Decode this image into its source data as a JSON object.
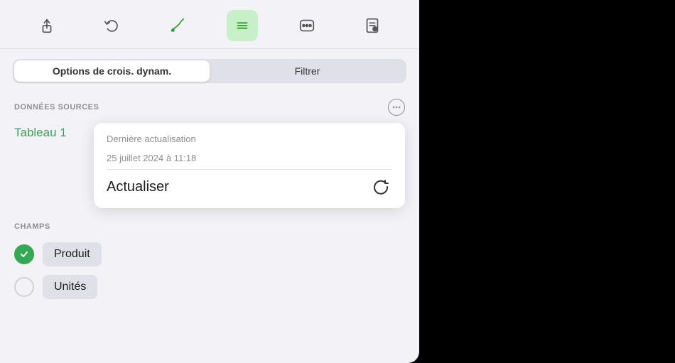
{
  "toolbar": {
    "buttons": [
      {
        "id": "share",
        "icon": "share",
        "active": false,
        "label": "Partager"
      },
      {
        "id": "undo",
        "icon": "undo",
        "active": false,
        "label": "Annuler"
      },
      {
        "id": "brush",
        "icon": "brush",
        "active": false,
        "label": "Pinceau"
      },
      {
        "id": "menu",
        "icon": "menu",
        "active": true,
        "label": "Menu"
      },
      {
        "id": "more",
        "icon": "more",
        "active": false,
        "label": "Plus"
      },
      {
        "id": "list",
        "icon": "list",
        "active": false,
        "label": "Liste"
      }
    ]
  },
  "segment": {
    "left_label": "Options de crois. dynam.",
    "right_label": "Filtrer"
  },
  "donnees_sources": {
    "section_label": "DONNÉES SOURCES",
    "source_name": "Tableau 1",
    "last_update_label": "Dernière actualisation",
    "last_update_time": "25 juillet 2024 à 11:18",
    "actualiser_label": "Actualiser"
  },
  "champs": {
    "section_label": "CHAMPS",
    "fields": [
      {
        "id": "produit",
        "label": "Produit",
        "checked": true
      },
      {
        "id": "unites",
        "label": "Unités",
        "checked": false
      }
    ]
  }
}
